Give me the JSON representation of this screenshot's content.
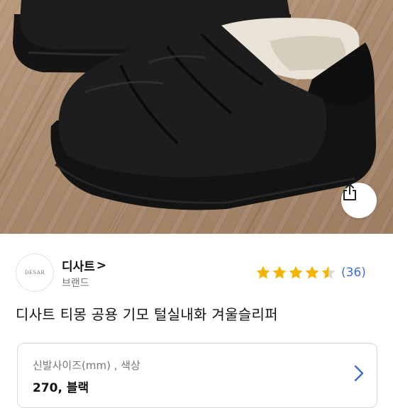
{
  "brand": {
    "logo_text": "DESAR",
    "name": "디사트",
    "name_chevron": ">",
    "subtitle": "브랜드"
  },
  "rating": {
    "stars": 4.5,
    "max_stars": 5,
    "review_count": "(36)",
    "star_color": "#f5b400"
  },
  "product": {
    "title": "디사트 티몽 공용 기모 털실내화 겨울슬리퍼"
  },
  "option": {
    "label": "신발사이즈(mm) , 색상",
    "value": "270, 블랙"
  },
  "icons": {
    "share": "share-icon",
    "option_arrow": "chevron-right-icon",
    "star": "star-icon"
  },
  "colors": {
    "link": "#3a6fd8",
    "chevron": "#3a6fd8"
  }
}
